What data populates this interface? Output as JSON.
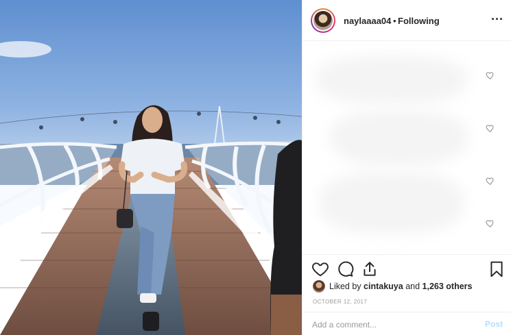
{
  "post": {
    "username": "naylaaaa04",
    "separator": "•",
    "follow_status": "Following",
    "more_icon": "more-horizontal-icon",
    "likes": {
      "prefix": "Liked by",
      "user": "cintakuya",
      "joiner": "and",
      "count_text": "1,263 others"
    },
    "date": "OCTOBER 12, 2017",
    "comment": {
      "placeholder": "Add a comment...",
      "value": "",
      "post_label": "Post"
    },
    "colors": {
      "post_button_disabled": "#b2dffc",
      "text": "#262626",
      "muted": "#999999",
      "border": "#efefef"
    }
  }
}
